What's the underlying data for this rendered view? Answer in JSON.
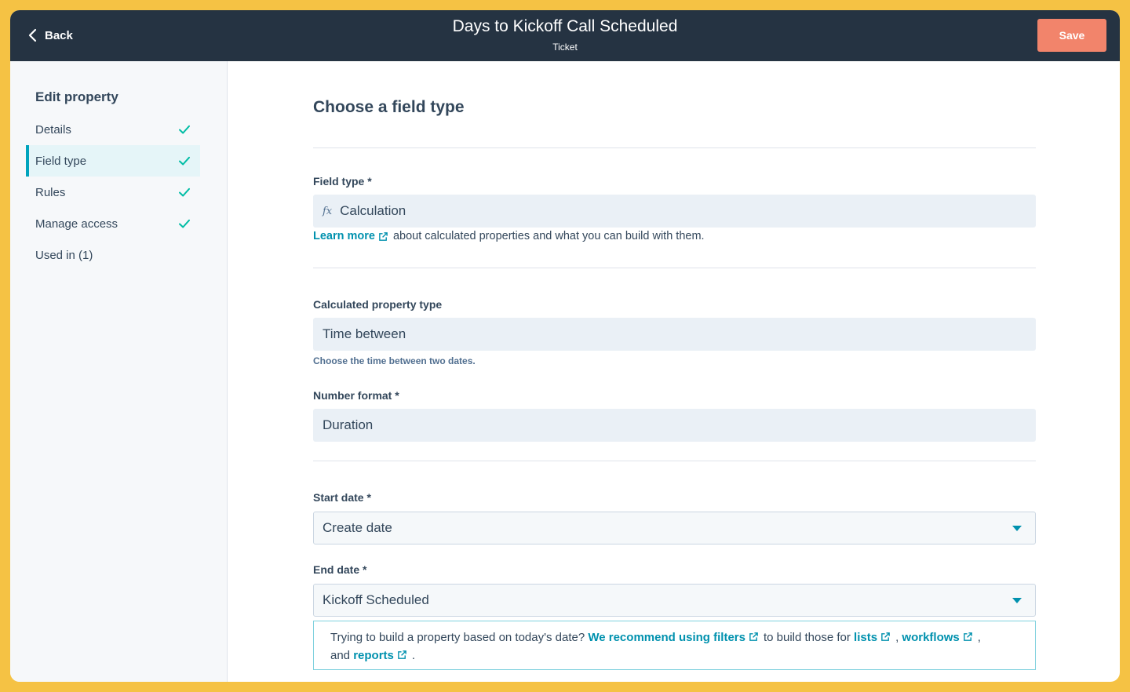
{
  "topbar": {
    "back_label": "Back",
    "title": "Days to Kickoff Call Scheduled",
    "subtitle": "Ticket",
    "save_label": "Save"
  },
  "sidebar": {
    "heading": "Edit property",
    "items": [
      {
        "label": "Details",
        "checked": true
      },
      {
        "label": "Field type",
        "checked": true,
        "active": true
      },
      {
        "label": "Rules",
        "checked": true
      },
      {
        "label": "Manage access",
        "checked": true
      },
      {
        "label": "Used in (1)",
        "checked": false
      }
    ]
  },
  "main": {
    "heading": "Choose a field type",
    "field_type": {
      "label": "Field type *",
      "icon": "fx",
      "value": "Calculation",
      "learn_more": "Learn more",
      "helper_text": "about calculated properties and what you can build with them."
    },
    "calc_type": {
      "label": "Calculated property type",
      "value": "Time between",
      "help": "Choose the time between two dates."
    },
    "number_format": {
      "label": "Number format *",
      "value": "Duration"
    },
    "start_date": {
      "label": "Start date *",
      "value": "Create date"
    },
    "end_date": {
      "label": "End date *",
      "value": "Kickoff Scheduled"
    },
    "notice": {
      "text1": "Trying to build a property based on today's date?",
      "link1": "We recommend using filters",
      "text2": "to build those for",
      "link2": "lists",
      "sep1": ",",
      "link3": "workflows",
      "sep2": ",",
      "text3": "and",
      "link4": "reports",
      "end": "."
    }
  },
  "colors": {
    "topbar_bg": "#253342",
    "save_button": "#f2846b",
    "accent": "#00a4bd",
    "link": "#0091ae",
    "check": "#00bda5",
    "frame": "#f5c244"
  }
}
